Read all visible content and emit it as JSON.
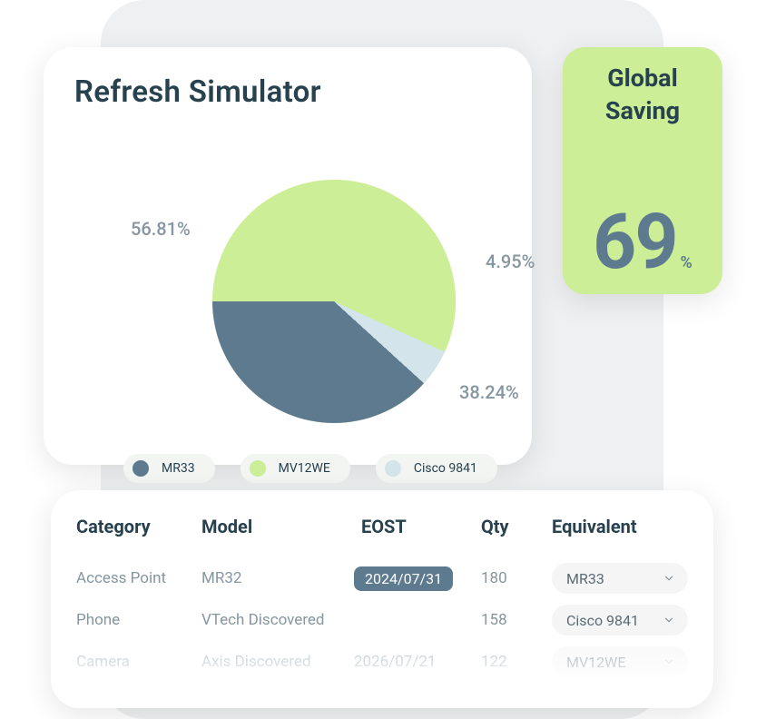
{
  "simulator": {
    "title": "Refresh Simulator",
    "labels": {
      "a": "56.81%",
      "b": "4.95%",
      "c": "38.24%"
    },
    "legend": [
      {
        "name": "MR33",
        "color": "#5d7a8e"
      },
      {
        "name": "MV12WE",
        "color": "#cbee97"
      },
      {
        "name": "Cisco 9841",
        "color": "#d3e4ea"
      }
    ]
  },
  "saving": {
    "title1": "Global",
    "title2": "Saving",
    "value": "69",
    "percent": "%"
  },
  "table": {
    "headers": {
      "category": "Category",
      "model": "Model",
      "eost": "EOST",
      "qty": "Qty",
      "equivalent": "Equivalent"
    },
    "rows": [
      {
        "category": "Access Point",
        "model": "MR32",
        "eost": "2024/07/31",
        "eost_highlight": true,
        "qty": "180",
        "equivalent": "MR33"
      },
      {
        "category": "Phone",
        "model": "VTech Discovered",
        "eost": "",
        "eost_highlight": false,
        "qty": "158",
        "equivalent": "Cisco 9841"
      },
      {
        "category": "Camera",
        "model": "Axis Discovered",
        "eost": "2026/07/21",
        "eost_highlight": false,
        "qty": "122",
        "equivalent": "MV12WE"
      }
    ]
  },
  "chart_data": {
    "type": "pie",
    "title": "Refresh Simulator",
    "series": [
      {
        "name": "MV12WE",
        "value": 56.81,
        "color": "#cbee97"
      },
      {
        "name": "MR33",
        "value": 38.24,
        "color": "#5d7a8e"
      },
      {
        "name": "Cisco 9841",
        "value": 4.95,
        "color": "#d3e4ea"
      }
    ]
  }
}
